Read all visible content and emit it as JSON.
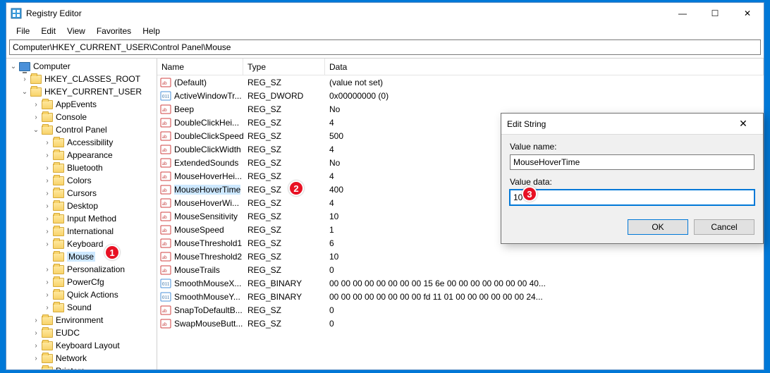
{
  "window": {
    "title": "Registry Editor",
    "controls": {
      "min": "—",
      "max": "☐",
      "close": "✕"
    }
  },
  "menubar": [
    "File",
    "Edit",
    "View",
    "Favorites",
    "Help"
  ],
  "address": "Computer\\HKEY_CURRENT_USER\\Control Panel\\Mouse",
  "tree": {
    "root": "Computer",
    "hives": {
      "classes": "HKEY_CLASSES_ROOT",
      "current": "HKEY_CURRENT_USER"
    },
    "cu_children": [
      "AppEvents",
      "Console",
      "Control Panel"
    ],
    "cp_children": [
      "Accessibility",
      "Appearance",
      "Bluetooth",
      "Colors",
      "Cursors",
      "Desktop",
      "Input Method",
      "International",
      "Keyboard",
      "Mouse",
      "Personalization",
      "PowerCfg",
      "Quick Actions",
      "Sound"
    ],
    "cu_after_cp": [
      "Environment",
      "EUDC",
      "Keyboard Layout",
      "Network",
      "Printers"
    ]
  },
  "columns": {
    "name": "Name",
    "type": "Type",
    "data": "Data"
  },
  "values": [
    {
      "icon": "sz",
      "name": "(Default)",
      "type": "REG_SZ",
      "data": "(value not set)"
    },
    {
      "icon": "bin",
      "name": "ActiveWindowTr...",
      "type": "REG_DWORD",
      "data": "0x00000000 (0)"
    },
    {
      "icon": "sz",
      "name": "Beep",
      "type": "REG_SZ",
      "data": "No"
    },
    {
      "icon": "sz",
      "name": "DoubleClickHei...",
      "type": "REG_SZ",
      "data": "4"
    },
    {
      "icon": "sz",
      "name": "DoubleClickSpeed",
      "type": "REG_SZ",
      "data": "500"
    },
    {
      "icon": "sz",
      "name": "DoubleClickWidth",
      "type": "REG_SZ",
      "data": "4"
    },
    {
      "icon": "sz",
      "name": "ExtendedSounds",
      "type": "REG_SZ",
      "data": "No"
    },
    {
      "icon": "sz",
      "name": "MouseHoverHei...",
      "type": "REG_SZ",
      "data": "4"
    },
    {
      "icon": "sz",
      "name": "MouseHoverTime",
      "type": "REG_SZ",
      "data": "400",
      "selected": true
    },
    {
      "icon": "sz",
      "name": "MouseHoverWi...",
      "type": "REG_SZ",
      "data": "4"
    },
    {
      "icon": "sz",
      "name": "MouseSensitivity",
      "type": "REG_SZ",
      "data": "10"
    },
    {
      "icon": "sz",
      "name": "MouseSpeed",
      "type": "REG_SZ",
      "data": "1"
    },
    {
      "icon": "sz",
      "name": "MouseThreshold1",
      "type": "REG_SZ",
      "data": "6"
    },
    {
      "icon": "sz",
      "name": "MouseThreshold2",
      "type": "REG_SZ",
      "data": "10"
    },
    {
      "icon": "sz",
      "name": "MouseTrails",
      "type": "REG_SZ",
      "data": "0"
    },
    {
      "icon": "bin",
      "name": "SmoothMouseX...",
      "type": "REG_BINARY",
      "data": "00 00 00 00 00 00 00 00 15 6e 00 00 00 00 00 00 00 40..."
    },
    {
      "icon": "bin",
      "name": "SmoothMouseY...",
      "type": "REG_BINARY",
      "data": "00 00 00 00 00 00 00 00 fd 11 01 00 00 00 00 00 00 24..."
    },
    {
      "icon": "sz",
      "name": "SnapToDefaultB...",
      "type": "REG_SZ",
      "data": "0"
    },
    {
      "icon": "sz",
      "name": "SwapMouseButt...",
      "type": "REG_SZ",
      "data": "0"
    }
  ],
  "dialog": {
    "title": "Edit String",
    "close": "✕",
    "value_name_label": "Value name:",
    "value_name": "MouseHoverTime",
    "value_data_label": "Value data:",
    "value_data": "10",
    "ok": "OK",
    "cancel": "Cancel"
  },
  "badges": {
    "b1": "1",
    "b2": "2",
    "b3": "3"
  }
}
